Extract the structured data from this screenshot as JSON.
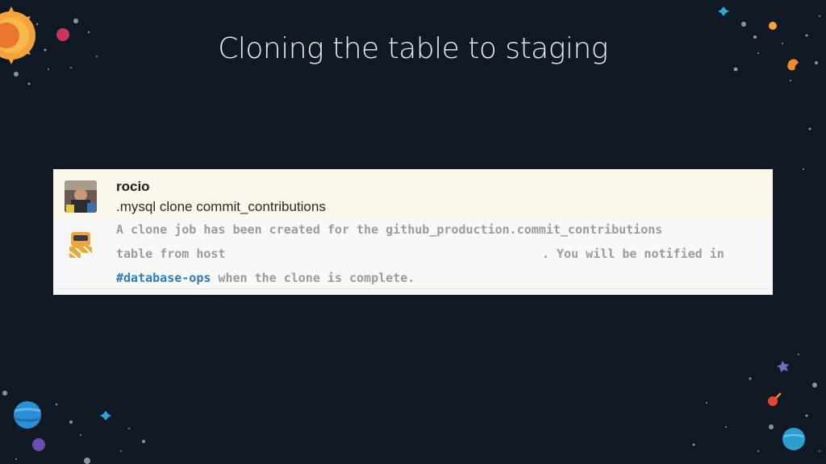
{
  "slide": {
    "title": "Cloning the table to staging"
  },
  "chat": {
    "user_message": {
      "username": "rocio",
      "text": ".mysql clone commit_contributions"
    },
    "bot_message": {
      "line1": "A clone job has been created for the github_production.commit_contributions",
      "line2": "table from host",
      "line2_tail": ". You will be notified in",
      "channel": "#database-ops",
      "line3_rest": " when the clone is complete."
    }
  },
  "colors": {
    "background": "#0f1923",
    "channel_link": "#2a7dc0"
  }
}
